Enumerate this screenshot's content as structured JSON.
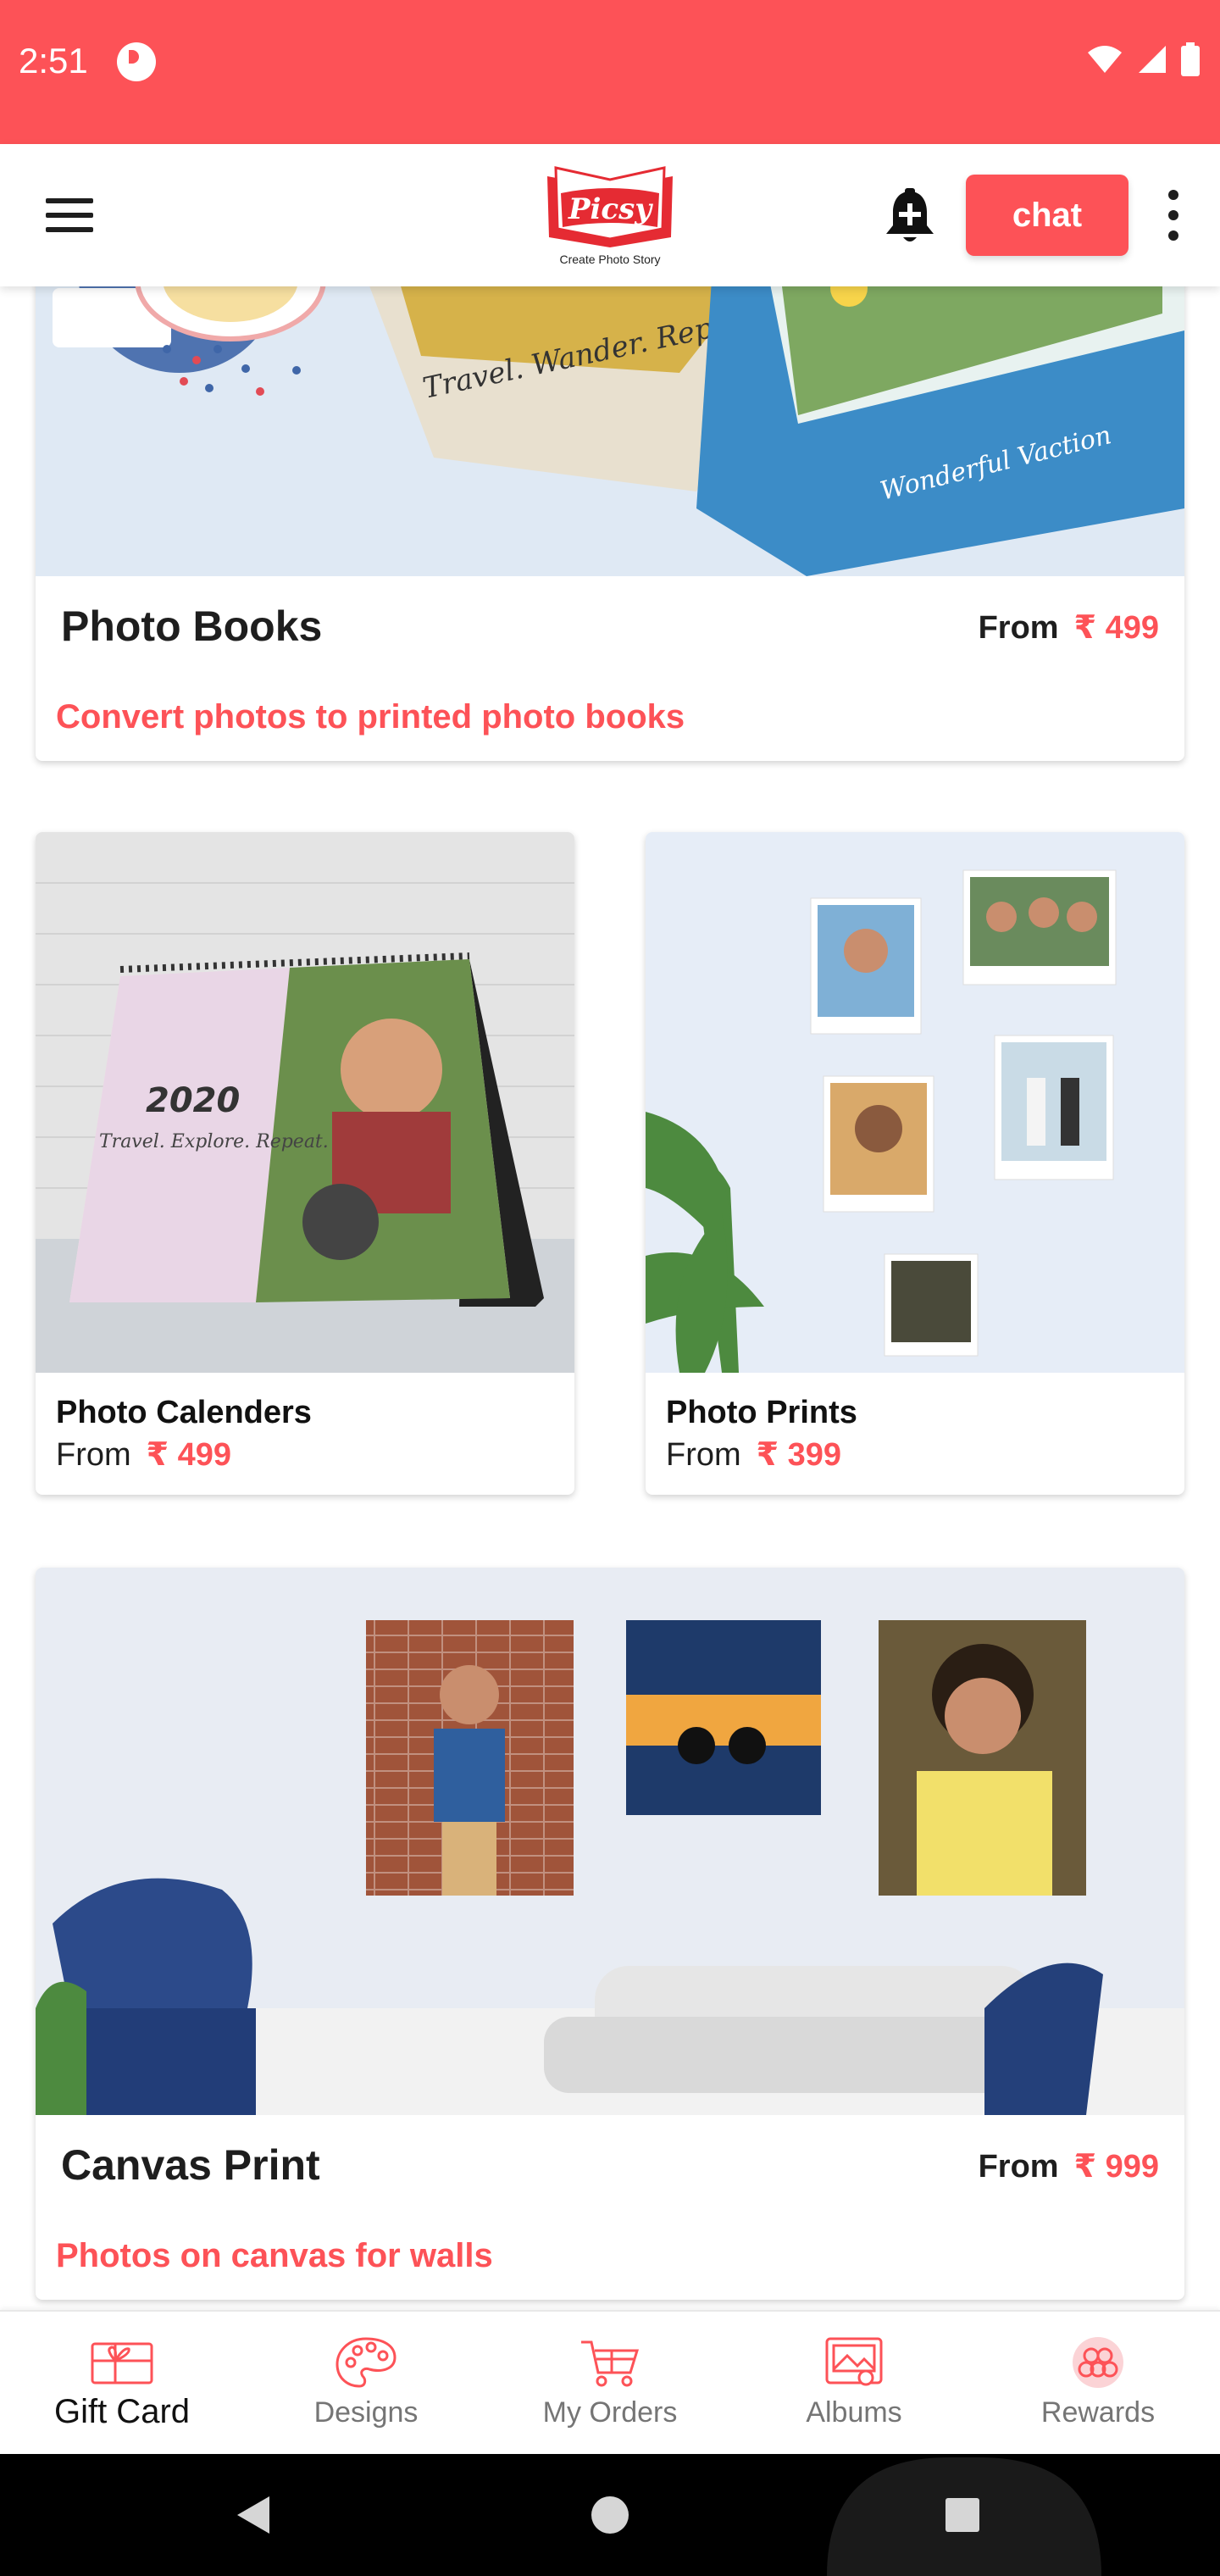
{
  "status_bar": {
    "time": "2:51",
    "bg_color": "#fd5257"
  },
  "toolbar": {
    "logo_text": "Picsy",
    "logo_tagline": "Create Photo Story",
    "chat_label": "chat",
    "accent_color": "#fd5257"
  },
  "cards": {
    "photo_books": {
      "title": "Photo Books",
      "from_label": "From",
      "price": "₹ 499",
      "subtitle": "Convert photos to printed photo books",
      "image_text_1": "Travel. Wander. Repeat.",
      "image_text_2": "Wonderful Vaction"
    },
    "photo_calendars": {
      "title": "Photo Calenders",
      "from_label": "From",
      "price": "₹ 499",
      "image_year": "2020",
      "image_text": "Travel. Explore. Repeat."
    },
    "photo_prints": {
      "title": "Photo Prints",
      "from_label": "From",
      "price": "₹ 399"
    },
    "canvas_print": {
      "title": "Canvas Print",
      "from_label": "From",
      "price": "₹ 999",
      "subtitle": "Photos on canvas for walls"
    }
  },
  "bottom_nav": {
    "items": [
      {
        "label": "Gift Card",
        "icon": "gift-card-icon",
        "active": true
      },
      {
        "label": "Designs",
        "icon": "palette-icon",
        "active": false
      },
      {
        "label": "My Orders",
        "icon": "cart-icon",
        "active": false
      },
      {
        "label": "Albums",
        "icon": "album-icon",
        "active": false
      },
      {
        "label": "Rewards",
        "icon": "rewards-icon",
        "active": false
      }
    ]
  }
}
